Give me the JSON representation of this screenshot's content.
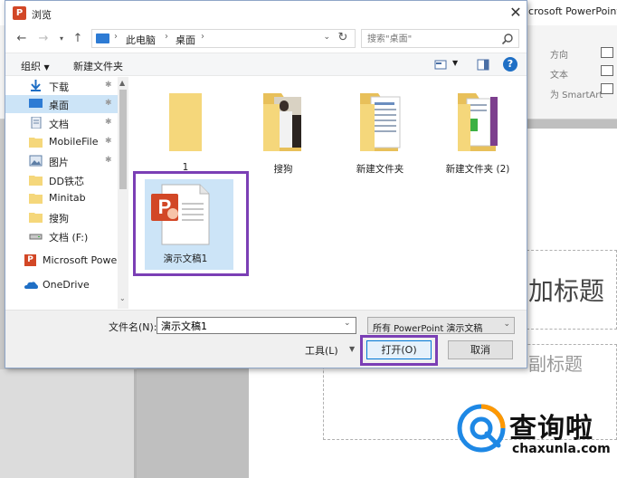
{
  "background": {
    "app_title": "icrosoft PowerPoint",
    "ribbon_texts": [
      "方向",
      "文本",
      "为 SmartArt"
    ],
    "slide_title": "加标题",
    "slide_subtitle": "副标题"
  },
  "dialog": {
    "title": "浏览",
    "nav": {
      "breadcrumb": [
        "此电脑",
        "桌面"
      ],
      "search_placeholder": "搜索\"桌面\""
    },
    "toolbar": {
      "organize": "组织",
      "new_folder": "新建文件夹"
    },
    "sidebar": {
      "items": [
        {
          "label": "下载",
          "icon": "download-icon",
          "pinned": true
        },
        {
          "label": "桌面",
          "icon": "desktop-icon",
          "pinned": true,
          "selected": true
        },
        {
          "label": "文档",
          "icon": "document-icon",
          "pinned": true
        },
        {
          "label": "MobileFile",
          "icon": "folder-icon",
          "pinned": true
        },
        {
          "label": "图片",
          "icon": "pictures-icon",
          "pinned": true
        },
        {
          "label": "DD铁芯",
          "icon": "folder-icon",
          "pinned": false
        },
        {
          "label": "Minitab",
          "icon": "folder-icon",
          "pinned": false
        },
        {
          "label": "搜狗",
          "icon": "folder-icon",
          "pinned": false
        },
        {
          "label": "文档 (F:)",
          "icon": "drive-icon",
          "pinned": false
        },
        {
          "label": "Microsoft Powe",
          "icon": "powerpoint-icon",
          "pinned": false
        },
        {
          "label": "OneDrive",
          "icon": "onedrive-icon",
          "pinned": false
        }
      ]
    },
    "files": [
      {
        "name": "1",
        "type": "folder-icon"
      },
      {
        "name": "搜狗",
        "type": "folder-photos-icon"
      },
      {
        "name": "新建文件夹",
        "type": "folder-documents-icon"
      },
      {
        "name": "新建文件夹 (2)",
        "type": "folder-books-icon"
      },
      {
        "name": "演示文稿1",
        "type": "pptx-file-icon",
        "selected": true
      }
    ],
    "bottom": {
      "filename_label": "文件名(N):",
      "filename_value": "演示文稿1",
      "filetype": "所有 PowerPoint 演示文稿",
      "tools": "工具(L)",
      "open": "打开(O)",
      "cancel": "取消"
    }
  },
  "watermark": {
    "title": "查询啦",
    "domain": "chaxunla.com"
  },
  "colors": {
    "accent": "#0078d7",
    "selection": "#cce4f7",
    "highlight_box": "#7b3fb5",
    "powerpoint": "#d24726",
    "folder": "#f5d77b"
  }
}
